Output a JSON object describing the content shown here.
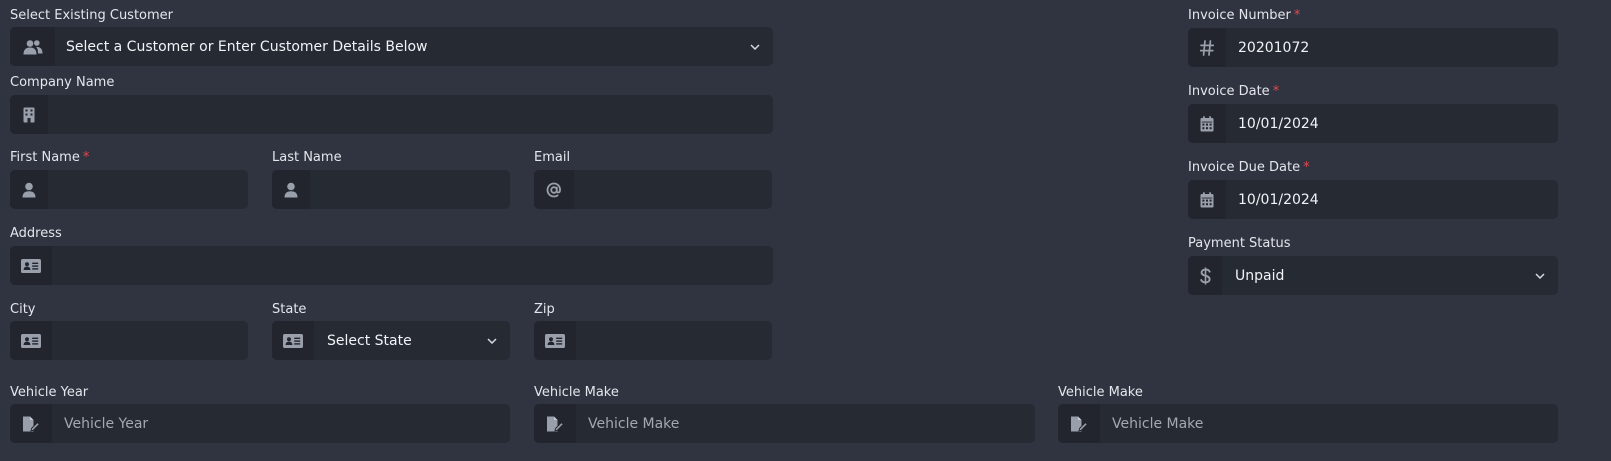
{
  "customer": {
    "label": "Select Existing Customer",
    "value": "Select a Customer or Enter Customer Details Below",
    "icon": "users-icon"
  },
  "company": {
    "label": "Company Name",
    "value": "",
    "icon": "building-icon"
  },
  "first_name": {
    "label": "First Name",
    "required": "*",
    "value": "",
    "icon": "user-icon"
  },
  "last_name": {
    "label": "Last Name",
    "value": "",
    "icon": "user-icon"
  },
  "email": {
    "label": "Email",
    "value": "",
    "icon": "at-icon"
  },
  "address": {
    "label": "Address",
    "value": "",
    "icon": "id-card-icon"
  },
  "city": {
    "label": "City",
    "value": "",
    "icon": "id-card-icon"
  },
  "state": {
    "label": "State",
    "value": "Select State",
    "icon": "id-card-icon"
  },
  "zip": {
    "label": "Zip",
    "value": "",
    "icon": "id-card-icon"
  },
  "vehicle_year": {
    "label": "Vehicle Year",
    "placeholder": "Vehicle Year",
    "icon": "file-edit-icon"
  },
  "vehicle_make_1": {
    "label": "Vehicle Make",
    "placeholder": "Vehicle Make",
    "icon": "file-edit-icon"
  },
  "vehicle_make_2": {
    "label": "Vehicle Make",
    "placeholder": "Vehicle Make",
    "icon": "file-edit-icon"
  },
  "invoice_number": {
    "label": "Invoice Number",
    "required": "*",
    "value": "20201072",
    "icon": "hash-icon"
  },
  "invoice_date": {
    "label": "Invoice Date",
    "required": "*",
    "value": "10/01/2024",
    "icon": "calendar-icon"
  },
  "invoice_due_date": {
    "label": "Invoice Due Date",
    "required": "*",
    "value": "10/01/2024",
    "icon": "calendar-icon"
  },
  "payment_status": {
    "label": "Payment Status",
    "value": "Unpaid",
    "icon": "dollar-icon"
  },
  "colors": {
    "background": "#2f3440",
    "field": "#262a33",
    "addon": "#22252d",
    "required": "#e5484d",
    "icon": "#9aa0ab"
  }
}
